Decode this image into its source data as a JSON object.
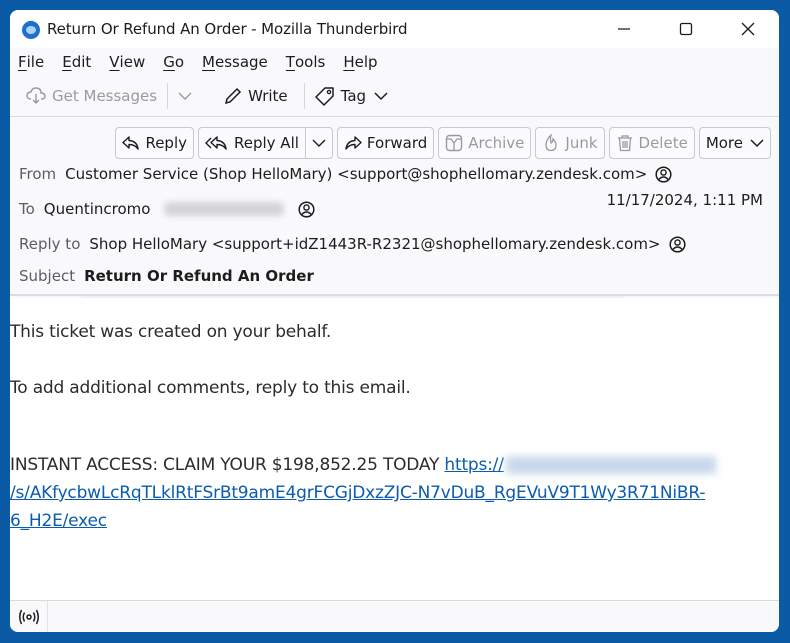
{
  "window": {
    "title": "Return Or Refund An Order - Mozilla Thunderbird",
    "controls": {
      "minimize": "minimize",
      "maximize": "maximize",
      "close": "close"
    }
  },
  "menubar": {
    "items": [
      {
        "label": "File",
        "accel": "F",
        "rest": "ile"
      },
      {
        "label": "Edit",
        "accel": "E",
        "rest": "dit"
      },
      {
        "label": "View",
        "accel": "V",
        "rest": "iew"
      },
      {
        "label": "Go",
        "accel": "G",
        "rest": "o"
      },
      {
        "label": "Message",
        "accel": "M",
        "rest": "essage"
      },
      {
        "label": "Tools",
        "accel": "T",
        "rest": "ools"
      },
      {
        "label": "Help",
        "accel": "H",
        "rest": "elp"
      }
    ]
  },
  "toolbar": {
    "get_messages": "Get Messages",
    "write": "Write",
    "tag": "Tag"
  },
  "header_toolbar": {
    "reply": "Reply",
    "reply_all": "Reply All",
    "forward": "Forward",
    "archive": "Archive",
    "junk": "Junk",
    "delete": "Delete",
    "more": "More"
  },
  "message": {
    "from_label": "From",
    "from_value": "Customer Service (Shop HelloMary) <support@shophellomary.zendesk.com>",
    "to_label": "To",
    "to_value": "Quentincromo",
    "date": "11/17/2024, 1:11 PM",
    "reply_to_label": "Reply to",
    "reply_to_value": "Shop HelloMary <support+idZ1443R-R2321@shophellomary.zendesk.com>",
    "subject_label": "Subject",
    "subject_value": "Return Or Refund An Order"
  },
  "body": {
    "line1": "This ticket was created on your behalf.",
    "line2": "To add additional comments, reply to this email.",
    "line3_text": "INSTANT ACCESS: CLAIM YOUR $198,852.25 TODAY ",
    "link_start": "https://",
    "link_line2": "/s/AKfycbwLcRqTLklRtFSrBt9amE4grFCGjDxzZJC-N7vDuB_RgEVuV9T1Wy3R71NiBR-",
    "link_line3": "6_H2E/exec"
  },
  "colors": {
    "accent": "#0b5aa6",
    "link": "#0b5cad"
  }
}
